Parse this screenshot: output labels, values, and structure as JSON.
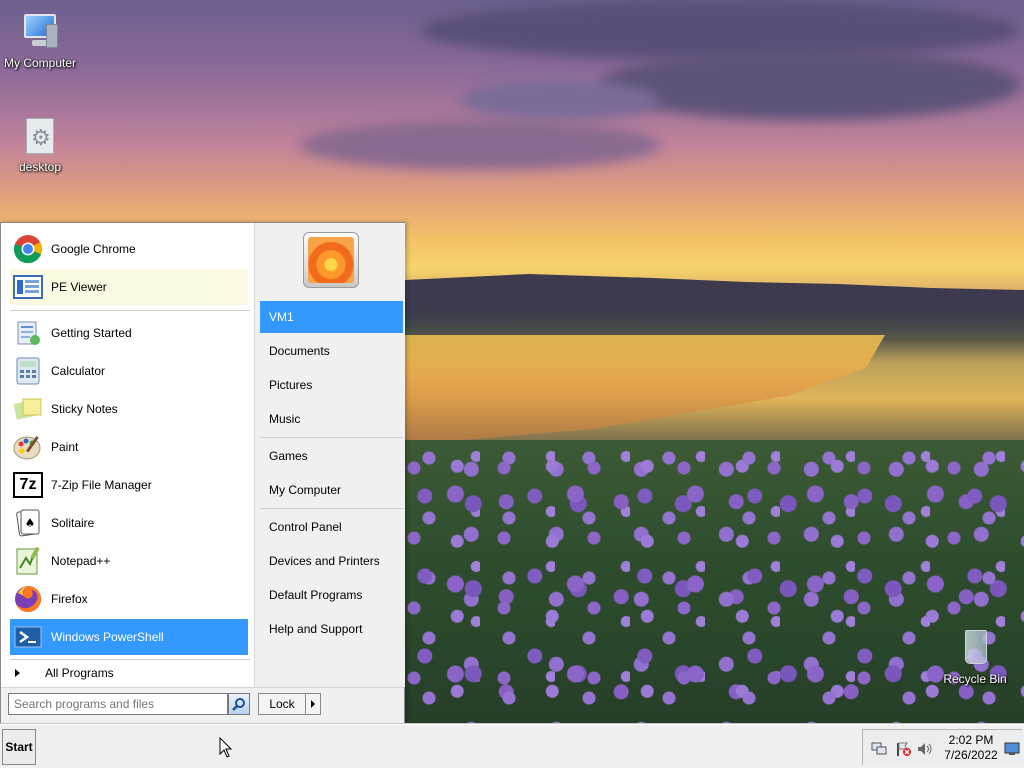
{
  "desktop": {
    "icons": [
      {
        "label": "My Computer",
        "icon": "computer-icon"
      },
      {
        "label": "desktop",
        "icon": "settings-file-icon"
      },
      {
        "label": "Recycle Bin",
        "icon": "recycle-bin-icon"
      }
    ]
  },
  "start_menu": {
    "programs": [
      {
        "label": "Google Chrome",
        "icon": "chrome-icon"
      },
      {
        "label": "PE Viewer",
        "icon": "pe-viewer-icon"
      },
      {
        "label": "Getting Started",
        "icon": "getting-started-icon"
      },
      {
        "label": "Calculator",
        "icon": "calculator-icon"
      },
      {
        "label": "Sticky Notes",
        "icon": "sticky-notes-icon"
      },
      {
        "label": "Paint",
        "icon": "paint-icon"
      },
      {
        "label": "7-Zip File Manager",
        "icon": "7zip-icon",
        "icon_text": "7z"
      },
      {
        "label": "Solitaire",
        "icon": "solitaire-icon"
      },
      {
        "label": "Notepad++",
        "icon": "notepadpp-icon"
      },
      {
        "label": "Firefox",
        "icon": "firefox-icon"
      },
      {
        "label": "Windows PowerShell",
        "icon": "powershell-icon"
      }
    ],
    "all_programs": "All Programs",
    "right_links": [
      {
        "label": "VM1"
      },
      {
        "label": "Documents"
      },
      {
        "label": "Pictures"
      },
      {
        "label": "Music"
      },
      {
        "label": "Games"
      },
      {
        "label": "My Computer"
      },
      {
        "label": "Control Panel"
      },
      {
        "label": "Devices and Printers"
      },
      {
        "label": "Default Programs"
      },
      {
        "label": "Help and Support"
      }
    ],
    "search": {
      "placeholder": "Search programs and files"
    },
    "lock_label": "Lock"
  },
  "taskbar": {
    "start_label": "Start",
    "clock": {
      "time": "2:02 PM",
      "date": "7/26/2022"
    }
  },
  "colors": {
    "highlight": "#3399ff",
    "hover_yellow": "#fbf9e2"
  }
}
